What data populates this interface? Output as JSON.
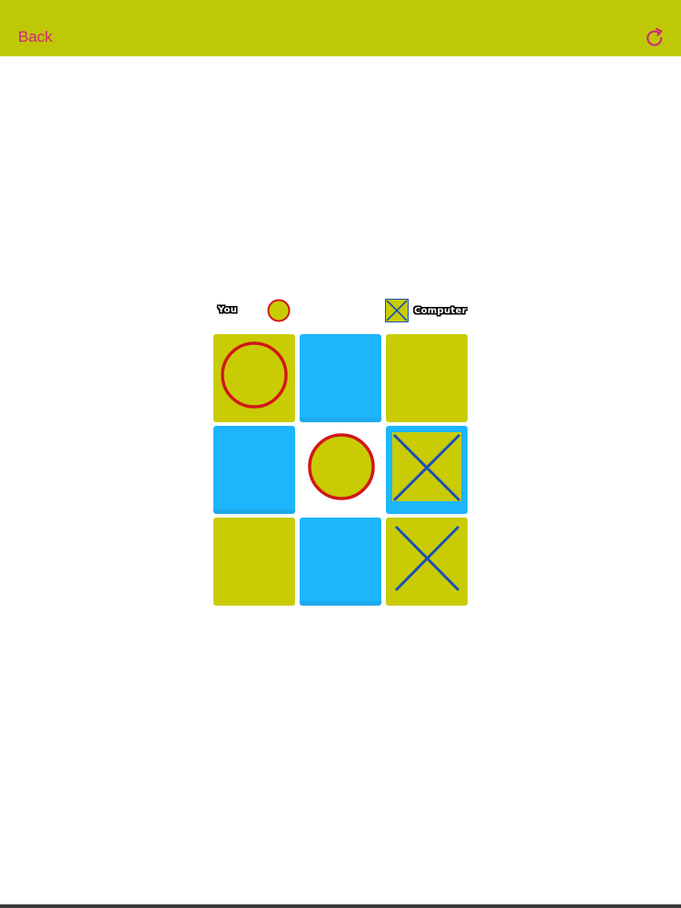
{
  "nav": {
    "back_label": "Back",
    "refresh_icon": "refresh-icon",
    "bar_color": "#bfc807",
    "accent_color": "#d0237a"
  },
  "players": {
    "you_label": "You",
    "you_mark": "O",
    "computer_label": "Computer",
    "computer_mark": "X"
  },
  "board": {
    "cells": [
      [
        "O",
        "",
        ""
      ],
      [
        "",
        "O",
        "X"
      ],
      [
        "",
        "",
        "X"
      ]
    ],
    "cell_colors": [
      [
        "yellow",
        "blue",
        "yellow"
      ],
      [
        "blue",
        "none",
        "blue"
      ],
      [
        "yellow",
        "blue",
        "yellow"
      ]
    ],
    "highlighted_cell": [
      1,
      2
    ]
  },
  "colors": {
    "yellow": "#c9cc05",
    "blue": "#1db5fb",
    "o_stroke": "#d11818",
    "x_stroke": "#1a4fb5"
  }
}
